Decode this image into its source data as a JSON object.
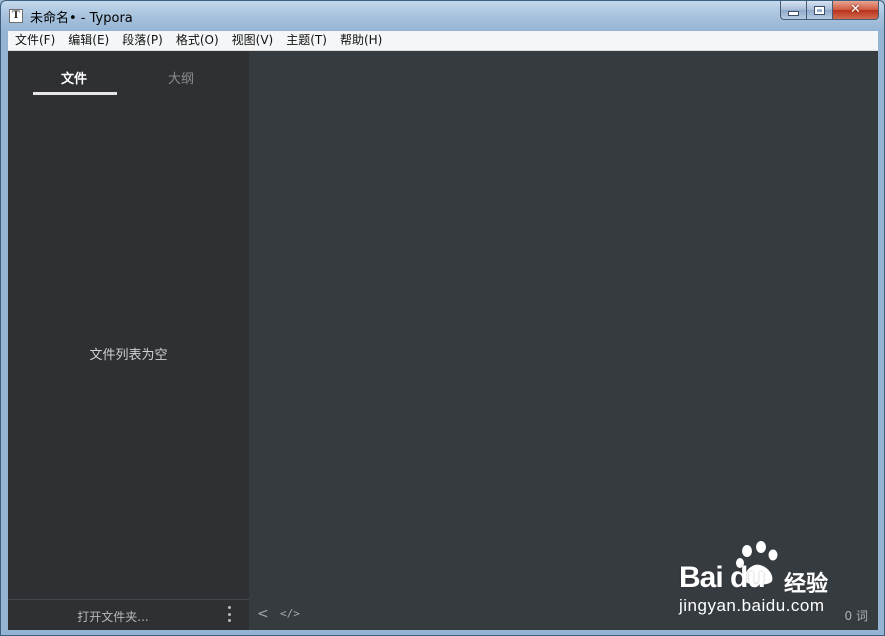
{
  "window": {
    "title": "未命名• - Typora",
    "app_icon_glyph": "T",
    "controls": {
      "minimize": "minimize",
      "maximize": "maximize",
      "close": "✕"
    }
  },
  "menubar": {
    "items": [
      "文件(F)",
      "编辑(E)",
      "段落(P)",
      "格式(O)",
      "视图(V)",
      "主题(T)",
      "帮助(H)"
    ]
  },
  "sidebar": {
    "tabs": [
      {
        "label": "文件",
        "active": true
      },
      {
        "label": "大纲",
        "active": false
      }
    ],
    "empty_message": "文件列表为空",
    "footer": {
      "open_folder": "打开文件夹..."
    }
  },
  "editor": {
    "footer": {
      "back_icon": "<",
      "source_icon": "</>",
      "word_count": "0 词"
    }
  },
  "watermark": {
    "logo": "Bai  du",
    "cn": "经验",
    "url": "jingyan.baidu.com"
  },
  "colors": {
    "sidebar_bg": "#2e3033",
    "editor_bg": "#363b40",
    "menubar_bg": "#f5f6f7",
    "close_button": "#c8442a"
  }
}
